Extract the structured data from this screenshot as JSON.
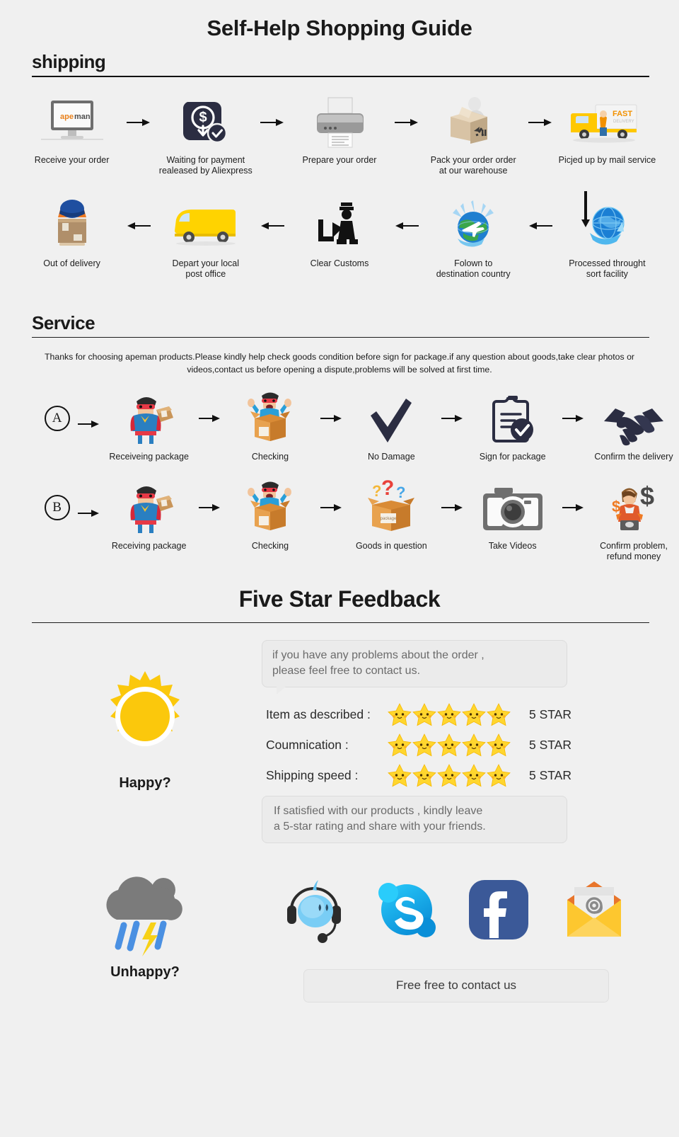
{
  "page": {
    "title": "Self-Help Shopping Guide",
    "background": "#f0f0f0"
  },
  "shipping": {
    "heading": "shipping",
    "row1": [
      {
        "label": "Receive your order",
        "icon": "monitor-apeman-icon"
      },
      {
        "label": "Waiting for payment\nrealeased by Aliexpress",
        "label_line1": "Waiting for payment",
        "label_line2": "realeased by Aliexpress",
        "icon": "payment-dollar-icon"
      },
      {
        "label": "Prepare your order",
        "icon": "printer-icon"
      },
      {
        "label_line1": "Pack your order order",
        "label_line2": "at our warehouse",
        "icon": "packing-box-icon"
      },
      {
        "label": "Picjed up by mail service",
        "icon": "fast-delivery-truck-icon"
      }
    ],
    "row2": [
      {
        "label": "Out of delivery",
        "icon": "courier-parcel-icon"
      },
      {
        "label_line1": "Depart your local",
        "label_line2": "post office",
        "icon": "yellow-van-icon"
      },
      {
        "label": "Clear Customs",
        "icon": "customs-officer-icon"
      },
      {
        "label_line1": "Folown to",
        "label_line2": "destination country",
        "icon": "globe-plane-icon"
      },
      {
        "label_line1": "Processed throught",
        "label_line2": "sort facility",
        "icon": "globe-sort-icon"
      }
    ]
  },
  "service": {
    "heading": "Service",
    "paragraph_line1": "Thanks for choosing apeman products.Please kindly help check goods condition before sign for package.if any question about",
    "paragraph_line2": "goods,take clear photos or videos,contact us before opening a dispute,problems will be solved at first time.",
    "rowA": {
      "badge": "A",
      "steps": [
        {
          "label": "Receiveing package",
          "icon": "hero-with-parcel-icon"
        },
        {
          "label": "Checking",
          "icon": "hero-in-box-icon"
        },
        {
          "label": "No Damage",
          "icon": "checkmark-icon"
        },
        {
          "label": "Sign for package",
          "icon": "clipboard-check-icon"
        },
        {
          "label": "Confirm the delivery",
          "icon": "handshake-icon"
        }
      ]
    },
    "rowB": {
      "badge": "B",
      "steps": [
        {
          "label": "Receiving package",
          "icon": "hero-with-parcel-icon"
        },
        {
          "label": "Checking",
          "icon": "hero-in-box-icon"
        },
        {
          "label": "Goods in question",
          "icon": "box-question-marks-icon"
        },
        {
          "label": "Take Videos",
          "icon": "camera-icon"
        },
        {
          "label_line1": "Confirm problem,",
          "label_line2": "refund money",
          "icon": "support-refund-icon"
        }
      ]
    }
  },
  "feedback": {
    "heading": "Five Star Feedback",
    "happy_caption": "Happy?",
    "unhappy_caption": "Unhappy?",
    "bubble_top_line1": "if you have any problems about the order ,",
    "bubble_top_line2": "please feel free to contact us.",
    "bubble_bottom_line1": "If satisfied with our products ,  kindly leave",
    "bubble_bottom_line2": "a 5-star rating and share with your friends.",
    "ratings": [
      {
        "label": "Item as described :",
        "stars": 5,
        "value": "5 STAR"
      },
      {
        "label": "Coumnication :",
        "stars": 5,
        "value": "5 STAR"
      },
      {
        "label": "Shipping speed :",
        "stars": 5,
        "value": "5 STAR"
      }
    ],
    "socials": [
      {
        "name": "aliwangwang-support-icon"
      },
      {
        "name": "skype-icon"
      },
      {
        "name": "facebook-icon"
      },
      {
        "name": "email-envelope-icon"
      }
    ],
    "contact_bar": "Free free to contact us"
  },
  "colors": {
    "star_yellow": "#FFD62E",
    "star_shadow": "#F5B700",
    "sun_yellow": "#FBC80C",
    "facebook_blue": "#3B5998",
    "skype_blue": "#00AFF0",
    "envelope_yellow": "#FDC72F",
    "dark_navy": "#2B2D42",
    "cloud_gray": "#7B7B7B",
    "rain_blue": "#4A90E2",
    "bolt_yellow": "#F7D117",
    "apeman_orange": "#E8801A",
    "truck_yellow": "#FFCC00"
  }
}
